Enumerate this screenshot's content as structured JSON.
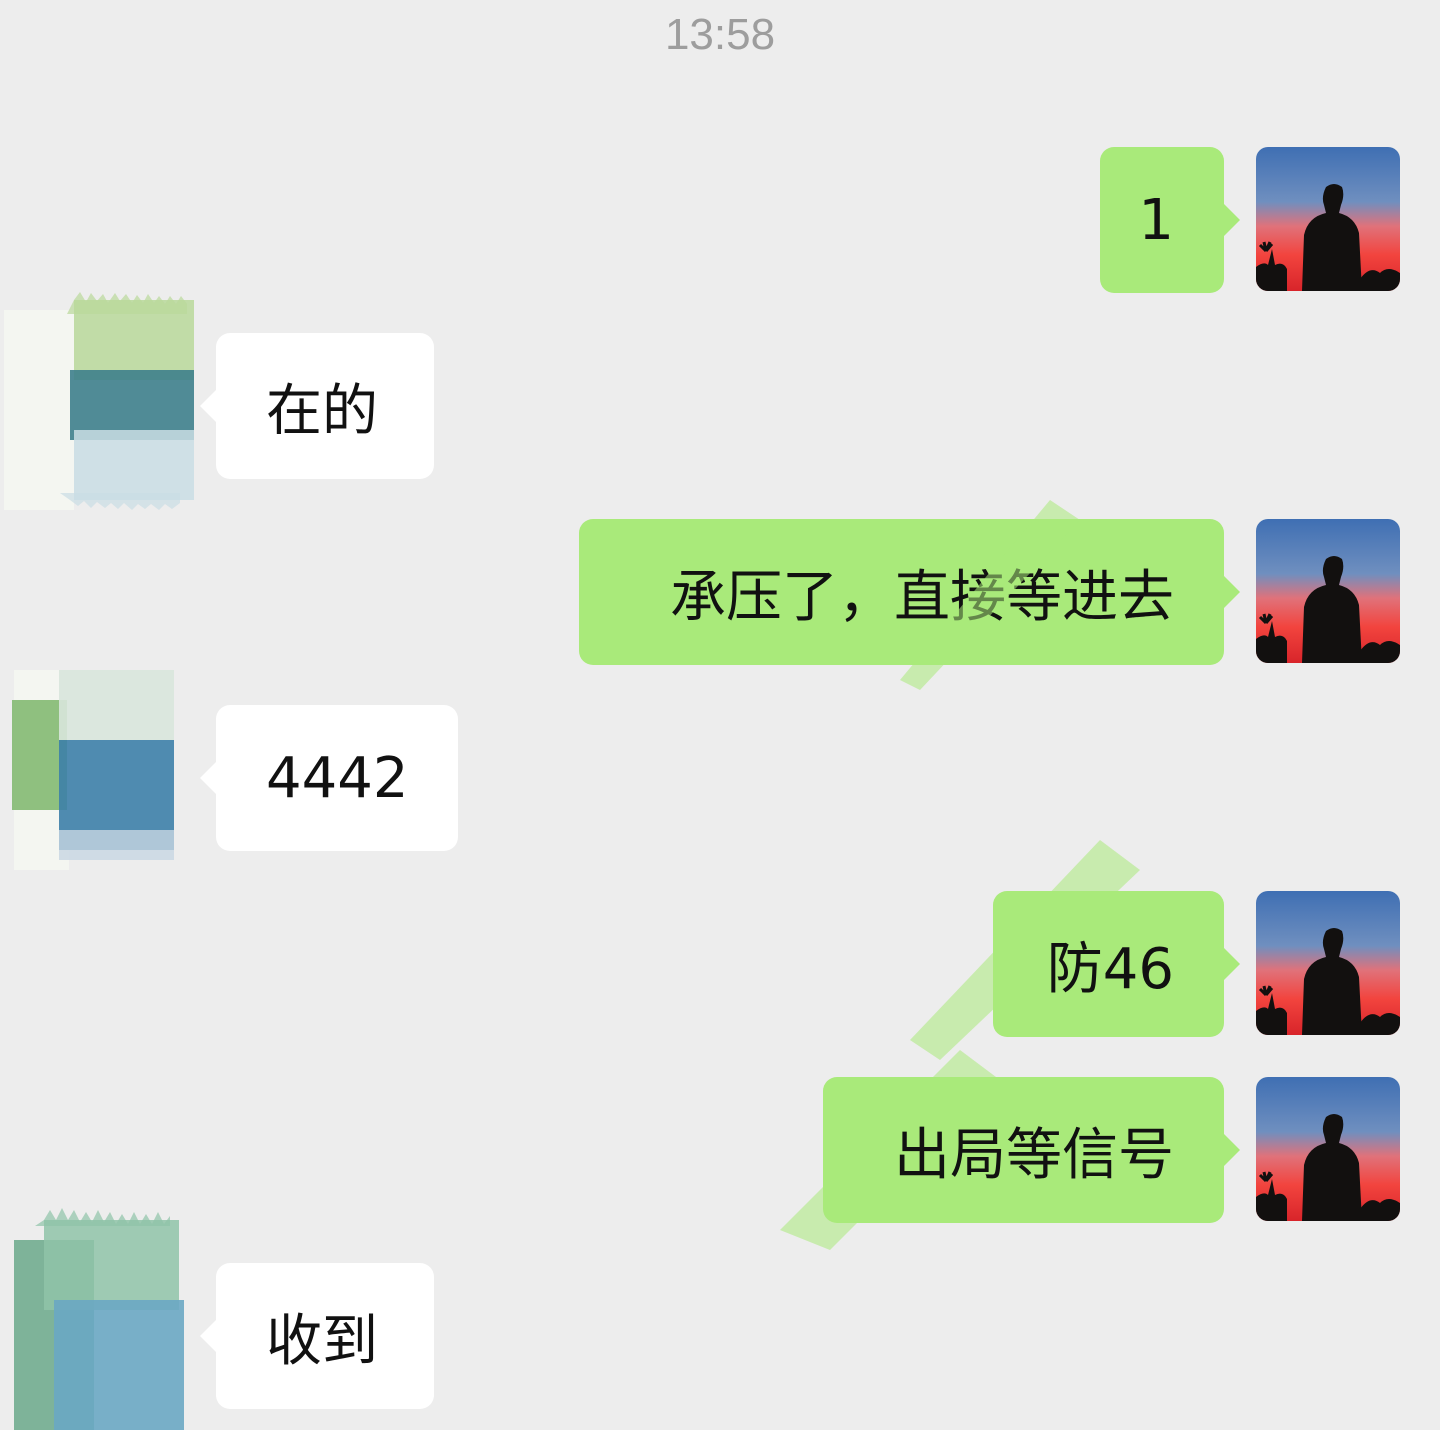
{
  "chat": {
    "timestamp": "13:58",
    "messages": [
      {
        "sender": "self",
        "text": "1"
      },
      {
        "sender": "contact",
        "text": "在的"
      },
      {
        "sender": "self",
        "text": "承压了，直接等进去"
      },
      {
        "sender": "contact",
        "text": "4442"
      },
      {
        "sender": "self",
        "text": "防46"
      },
      {
        "sender": "self",
        "text": "出局等信号"
      },
      {
        "sender": "contact",
        "text": "收到"
      }
    ]
  },
  "colors": {
    "background": "#ededed",
    "outgoing_bubble": "#a9ea7a",
    "incoming_bubble": "#ffffff",
    "timestamp_text": "#9d9d9d"
  },
  "icons": {
    "self_avatar": "sunset-silhouette-avatar",
    "contact_avatar": "watercolor-swatch-avatar"
  }
}
